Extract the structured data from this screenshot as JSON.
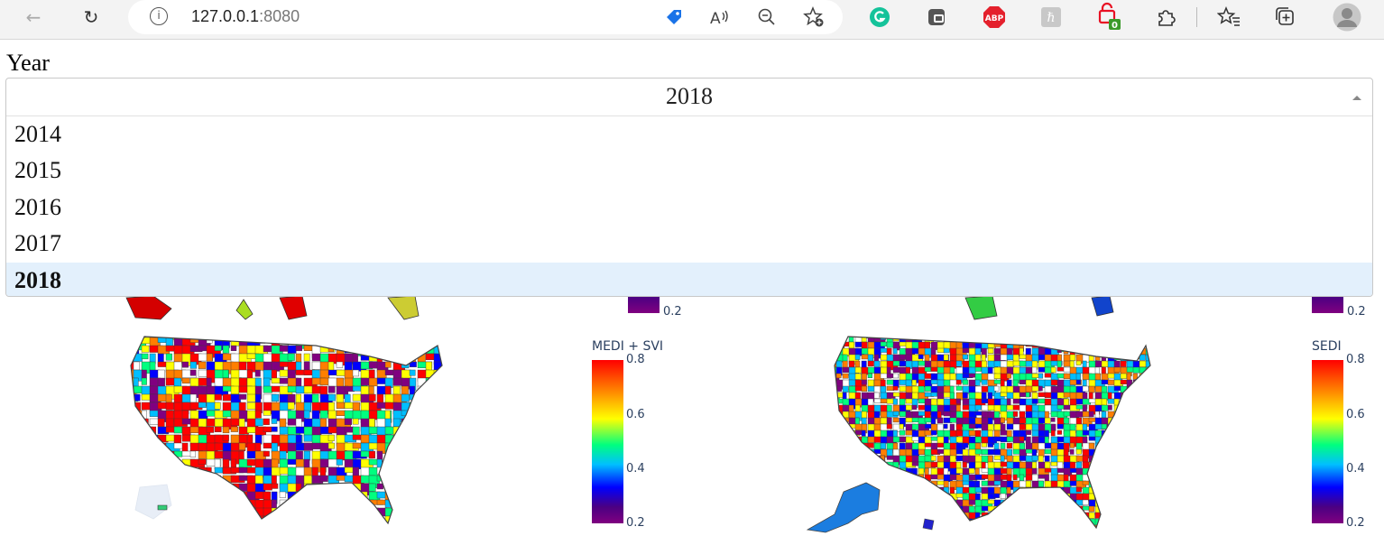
{
  "browser": {
    "url_host": "127.0.0.1",
    "url_port": ":8080",
    "ext_badge": "0",
    "ext_abp": "ABP"
  },
  "year_filter": {
    "label": "Year",
    "selected": "2018",
    "options": [
      "2014",
      "2015",
      "2016",
      "2017",
      "2018"
    ]
  },
  "maps": [
    {
      "colorbar_title": "MEDI + SVI",
      "ticks": [
        "0.8",
        "0.6",
        "0.4",
        "0.2"
      ],
      "top_tick": "0.2"
    },
    {
      "colorbar_title": "SEDI",
      "ticks": [
        "0.8",
        "0.6",
        "0.4",
        "0.2"
      ],
      "top_tick": "0.2"
    }
  ],
  "colorscale": [
    "#800080",
    "#0000ff",
    "#00bfff",
    "#00ff7f",
    "#ffff00",
    "#ff7f00",
    "#ff0000"
  ]
}
